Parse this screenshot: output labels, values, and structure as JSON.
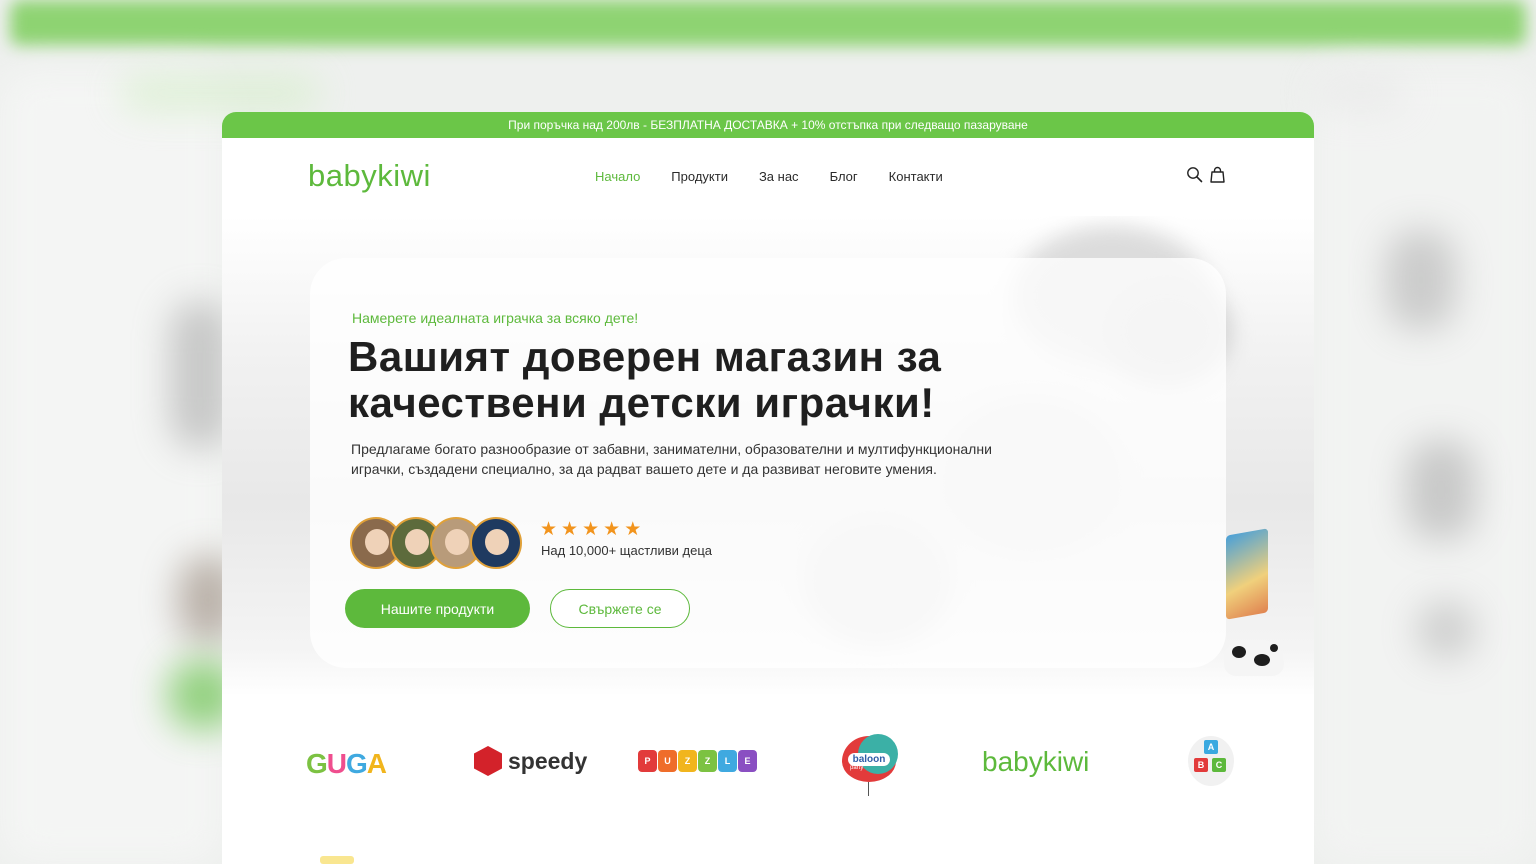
{
  "promo": {
    "text": "При поръчка над 200лв - БЕЗПЛАТНА ДОСТАВКА + 10% отстъпка при следващо пазаруване"
  },
  "header": {
    "logo": "babykiwi",
    "nav": [
      {
        "label": "Начало",
        "active": true
      },
      {
        "label": "Продукти",
        "active": false
      },
      {
        "label": "За нас",
        "active": false
      },
      {
        "label": "Блог",
        "active": false
      },
      {
        "label": "Контакти",
        "active": false
      }
    ],
    "icons": [
      "search-icon",
      "shopping-bag-icon"
    ]
  },
  "hero": {
    "eyebrow": "Намерете идеалната играчка за всяко дете!",
    "title_line1": "Вашият доверен магазин за",
    "title_line2": "качествени детски играчки!",
    "description": "Предлагаме богато разнообразие от забавни, занимателни, образователни и мултифункционални играчки, създадени специално, за да радват вашето дете и да развиват неговите умения.",
    "rating": 5,
    "social_proof": "Над 10,000+ щастливи деца",
    "primary_button": "Нашите продукти",
    "secondary_button": "Свържете се"
  },
  "brands": {
    "guga": [
      "G",
      "U",
      "G",
      "A"
    ],
    "speedy": "speedy",
    "puzzle": [
      "P",
      "U",
      "Z",
      "Z",
      "L",
      "E"
    ],
    "balloon": "baloon",
    "balloon_sub": "party",
    "babykiwi": "babykiwi",
    "abc": [
      "A",
      "B",
      "C"
    ]
  },
  "colors": {
    "brand_green": "#5db93c",
    "promo_green": "#6bc648",
    "star_orange": "#f2941d"
  }
}
